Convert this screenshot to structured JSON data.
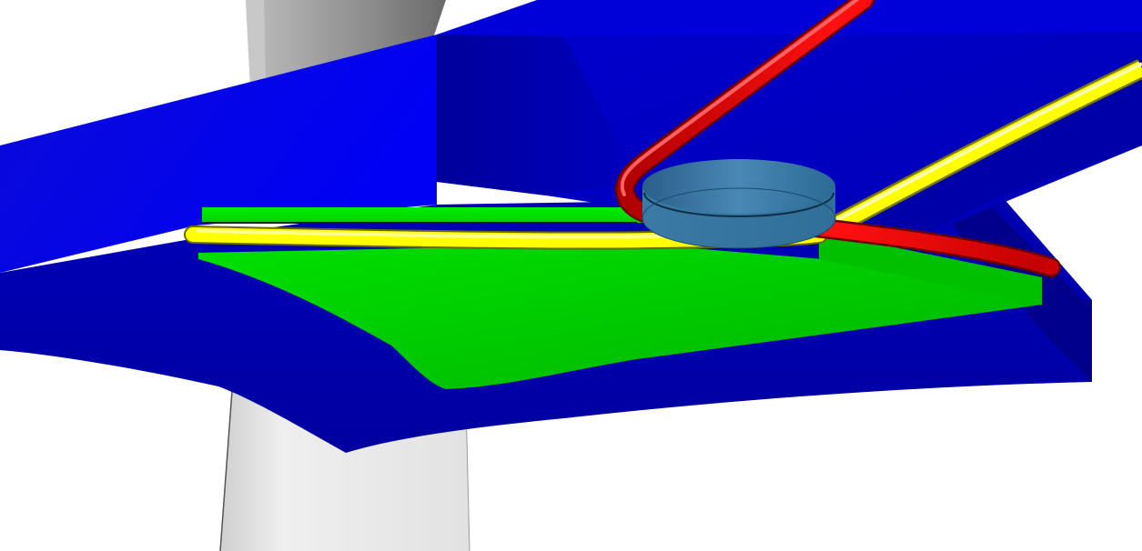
{
  "scene": {
    "kind": "3d-cad-render",
    "background": "#ffffff",
    "parts": [
      {
        "name": "lower-column",
        "color": "#e8e8e8"
      },
      {
        "name": "upper-column",
        "color": "#9a9a9a"
      },
      {
        "name": "blue-slab",
        "color": "#0000e6"
      },
      {
        "name": "blue-beam",
        "color": "#0000c8"
      },
      {
        "name": "green-plate",
        "color": "#00c800"
      },
      {
        "name": "center-disc",
        "color": "#2a6e9a"
      },
      {
        "name": "yellow-pipe",
        "color": "#ffff00"
      },
      {
        "name": "red-pipe",
        "color": "#ff0000"
      }
    ]
  }
}
